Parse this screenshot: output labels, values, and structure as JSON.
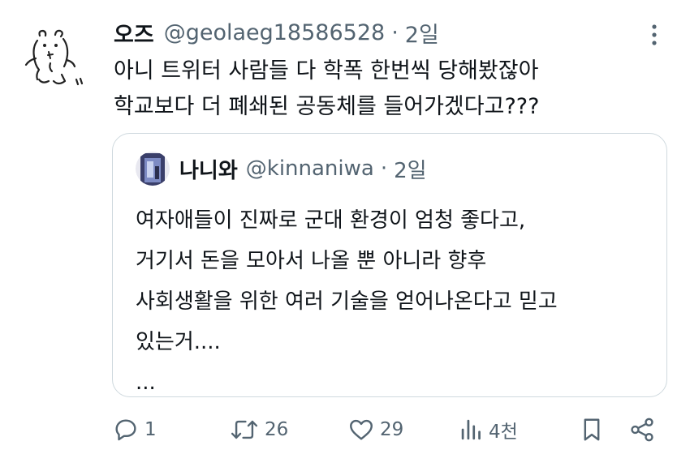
{
  "tweet": {
    "display_name": "오즈",
    "handle": "@geolaeg18586528",
    "separator": "·",
    "time": "2일",
    "avatar_icon": "bear-doodle-avatar",
    "lines": [
      "아니 트위터 사람들 다 학폭 한번씩 당해봤잖아",
      "학교보다 더 폐쇄된 공동체를 들어가겠다고???"
    ]
  },
  "quote": {
    "display_name": "나니와",
    "handle": "@kinnaniwa",
    "separator": "·",
    "time": "2일",
    "lines": [
      "여자애들이 진짜로 군대 환경이 엄청 좋다고,",
      "거기서 돈을 모아서 나올 뿐 아니라 향후",
      "사회생활을 위한 여러 기술을 얻어나온다고 믿고",
      "있는거....",
      "..."
    ]
  },
  "actions": {
    "reply": {
      "icon": "reply-icon",
      "count": "1"
    },
    "retweet": {
      "icon": "retweet-icon",
      "count": "26"
    },
    "like": {
      "icon": "heart-icon",
      "count": "29"
    },
    "views": {
      "icon": "views-icon",
      "count": "4천"
    },
    "bookmark": {
      "icon": "bookmark-icon"
    },
    "share": {
      "icon": "share-icon"
    }
  },
  "colors": {
    "text": "#0f1419",
    "secondary": "#536471",
    "border": "#cfd9de"
  }
}
